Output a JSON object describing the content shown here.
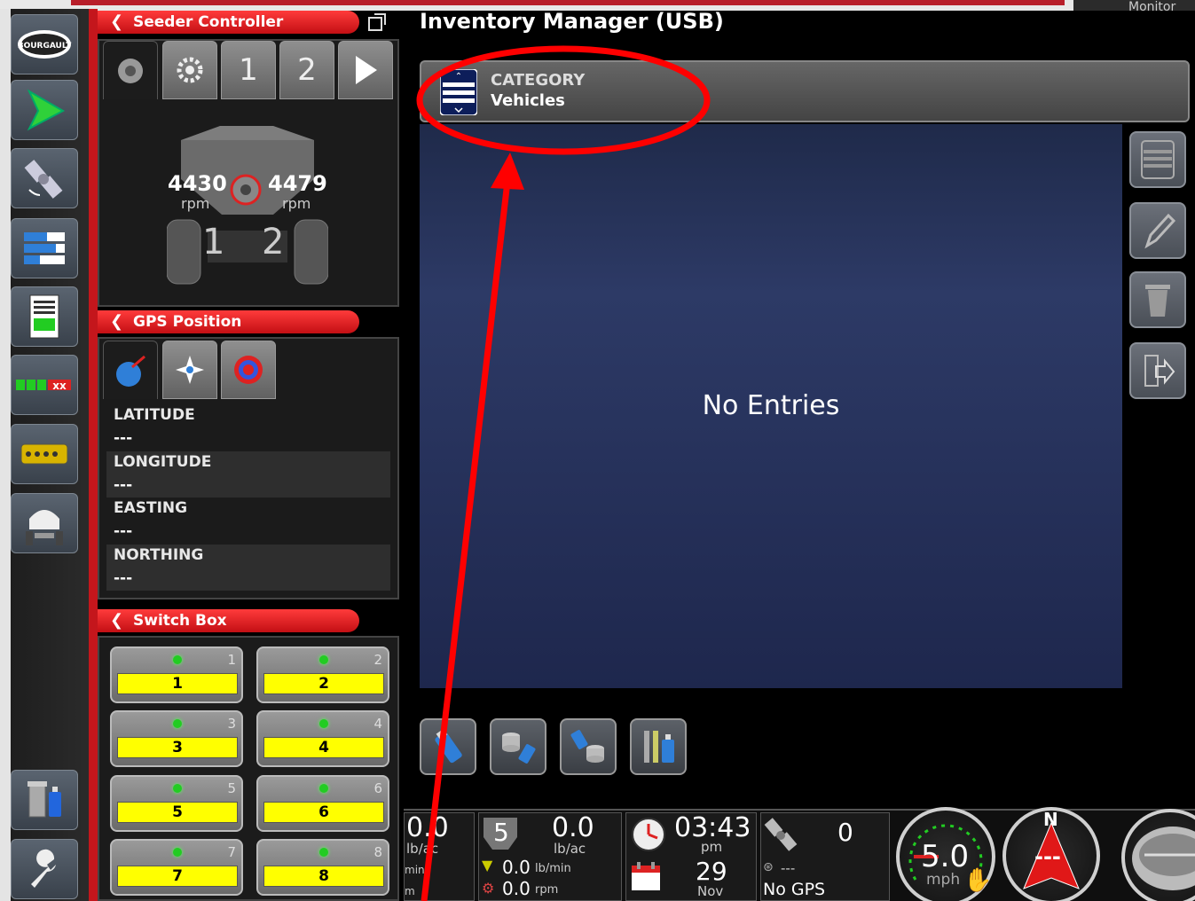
{
  "top": {
    "monitor_tab": "Monitor"
  },
  "rail": {
    "items": [
      {
        "name": "bourgault-logo",
        "label": "BOURGAULT"
      },
      {
        "name": "guidance-arrow-icon"
      },
      {
        "name": "gps-satellite-icon"
      },
      {
        "name": "layers-icon"
      },
      {
        "name": "report-icon"
      },
      {
        "name": "sections-icon",
        "label": "xx"
      },
      {
        "name": "switchbox-icon"
      },
      {
        "name": "seeder-cart-icon"
      }
    ],
    "bottom": [
      {
        "name": "inventory-usb-icon"
      },
      {
        "name": "wrench-icon"
      }
    ]
  },
  "seeder": {
    "title": "Seeder Controller",
    "tabs": [
      {
        "label": ""
      },
      {
        "label": ""
      },
      {
        "label": "1"
      },
      {
        "label": "2"
      },
      {
        "label": ""
      }
    ],
    "fan1": {
      "value": "4430",
      "unit": "rpm"
    },
    "fan2": {
      "value": "4479",
      "unit": "rpm"
    },
    "bin1": "1",
    "bin2": "2"
  },
  "gps": {
    "title": "GPS Position",
    "rows": [
      {
        "label": "LATITUDE",
        "value": "---"
      },
      {
        "label": "LONGITUDE",
        "value": "---"
      },
      {
        "label": "EASTING",
        "value": "---"
      },
      {
        "label": "NORTHING",
        "value": "---"
      }
    ]
  },
  "switchbox": {
    "title": "Switch Box",
    "switches": [
      {
        "num": "1",
        "label": "1"
      },
      {
        "num": "2",
        "label": "2"
      },
      {
        "num": "3",
        "label": "3"
      },
      {
        "num": "4",
        "label": "4"
      },
      {
        "num": "5",
        "label": "5"
      },
      {
        "num": "6",
        "label": "6"
      },
      {
        "num": "7",
        "label": "7"
      },
      {
        "num": "8",
        "label": "8"
      }
    ]
  },
  "inventory": {
    "title": "Inventory Manager (USB)",
    "category_label": "CATEGORY",
    "category_value": "Vehicles",
    "empty_text": "No Entries"
  },
  "status": {
    "rate1": {
      "value": "0.0",
      "unit": "lb/ac"
    },
    "rate1_left": "0.0",
    "rate1_left_unit": "lb/ac",
    "product_num": "5",
    "rate2": {
      "value": "0.0",
      "unit": "lb/ac"
    },
    "flow": {
      "value": "0.0",
      "unit": "lb/min"
    },
    "speed_rpm": {
      "value": "0.0",
      "unit": "rpm"
    },
    "left_unit1": "min",
    "left_unit2": "m",
    "time": {
      "value": "03:43",
      "ampm": "pm"
    },
    "date": {
      "day": "29",
      "month": "Nov"
    },
    "satellites": "0",
    "gps_quality": "---",
    "gps_status": "No GPS",
    "speed": {
      "value": "5.0",
      "unit": "mph"
    },
    "compass": {
      "heading": "N",
      "value": "---"
    }
  },
  "colors": {
    "accent_red": "#c4161c",
    "switch_yellow": "#ffff00",
    "list_blue": "#2d3a66"
  }
}
